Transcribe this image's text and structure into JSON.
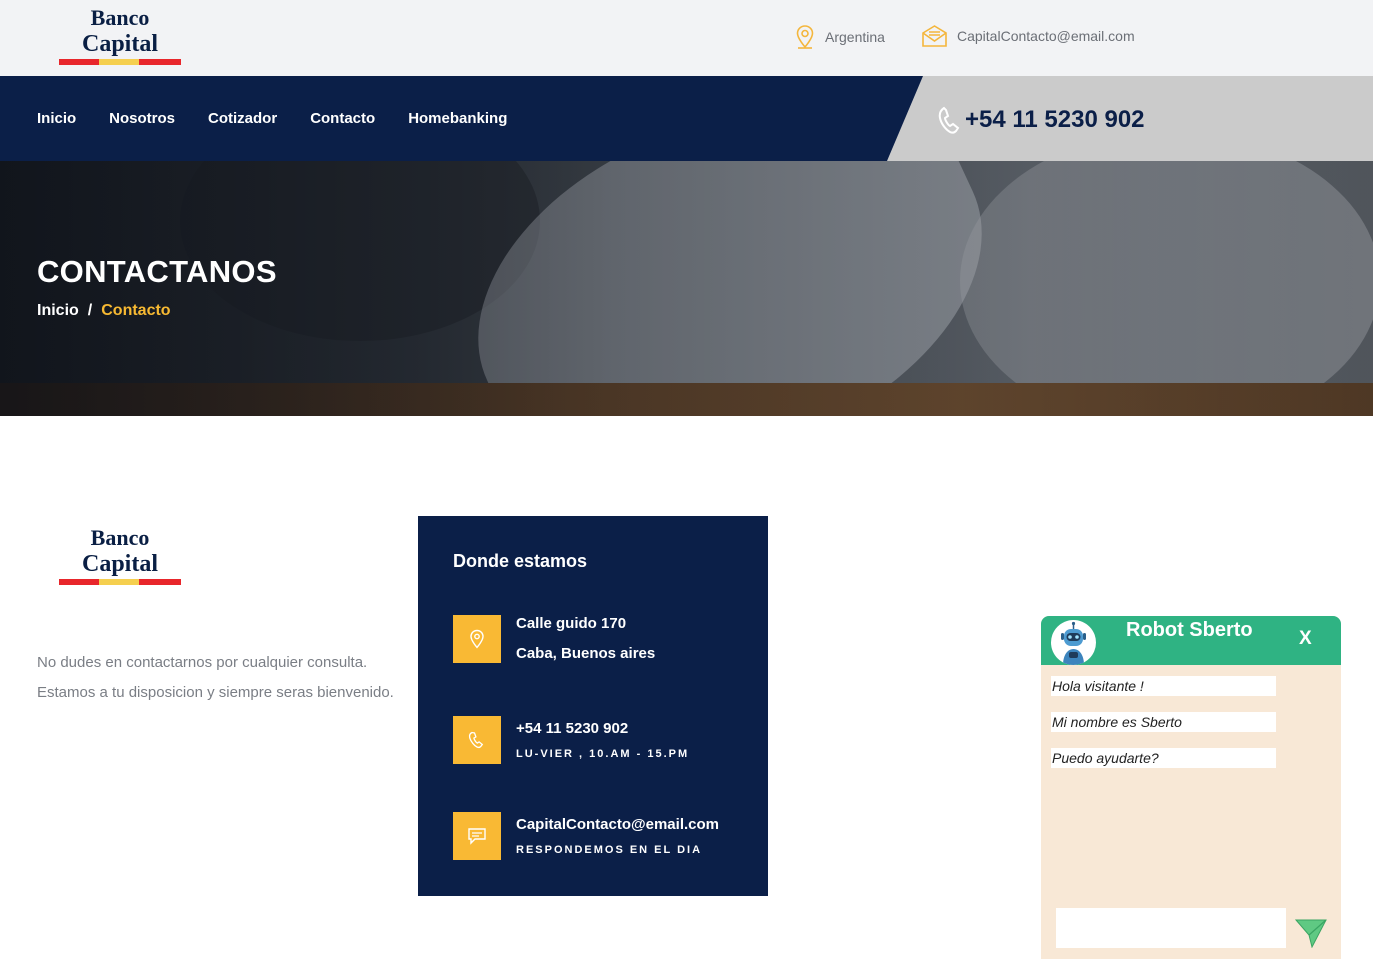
{
  "brand": {
    "line1": "Banco",
    "line2": "Capital",
    "stripe_colors": [
      "#e8262b",
      "#f5cf4f",
      "#e8262b"
    ]
  },
  "topbar": {
    "location": "Argentina",
    "email": "CapitalContacto@email.com",
    "location_icon": "map-pin-icon",
    "email_icon": "envelope-icon"
  },
  "nav": {
    "items": [
      "Inicio",
      "Nosotros",
      "Cotizador",
      "Contacto",
      "Homebanking"
    ],
    "phone": "+54 11 5230 902"
  },
  "hero": {
    "title": "CONTACTANOS",
    "breadcrumb_home": "Inicio",
    "breadcrumb_sep": "/",
    "breadcrumb_current": "Contacto"
  },
  "intro": {
    "text": "No dudes en contactarnos por cualquier consulta. Estamos a tu disposicion y siempre seras bienvenido."
  },
  "contact_card": {
    "title": "Donde estamos",
    "address_line1": "Calle guido 170",
    "address_line2": "Caba, Buenos aires",
    "phone": "+54 11 5230 902",
    "phone_hours": "LU-VIER , 10.AM - 15.PM",
    "email": "CapitalContacto@email.com",
    "email_note": "RESPONDEMOS EN EL DIA"
  },
  "chat": {
    "title": "Robot Sberto",
    "close": "X",
    "messages": [
      "Hola visitante !",
      "Mi nombre es Sberto",
      "Puedo ayudarte?"
    ],
    "input_value": ""
  },
  "colors": {
    "navy": "#0b1f48",
    "accent": "#f9b934",
    "chat_green": "#2fb383",
    "chat_bg": "#f8e8d6"
  }
}
